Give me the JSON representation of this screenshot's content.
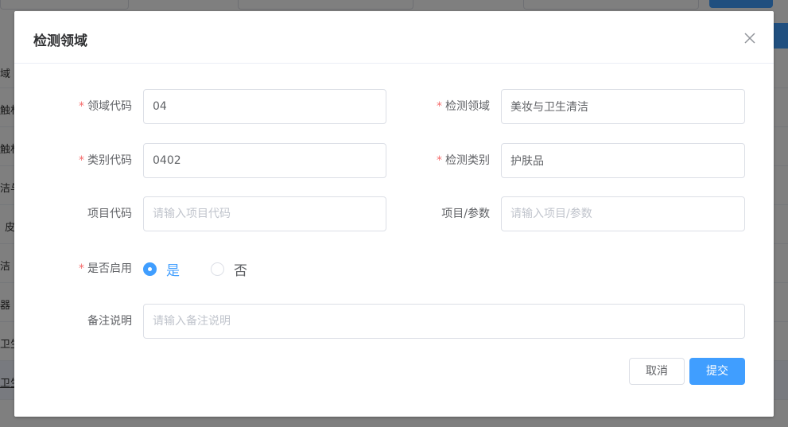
{
  "background": {
    "table_fragments": [
      "域",
      "触材",
      "触材",
      "洁与",
      "皮",
      "洁",
      "器",
      "卫生",
      "卫生"
    ]
  },
  "dialog": {
    "title": "检测领域",
    "fields": {
      "domain_code": {
        "label": "领域代码",
        "required": true,
        "value": "04",
        "placeholder": ""
      },
      "detection_domain": {
        "label": "检测领域",
        "required": true,
        "value": "美妆与卫生清洁",
        "placeholder": ""
      },
      "category_code": {
        "label": "类别代码",
        "required": true,
        "value": "0402",
        "placeholder": ""
      },
      "detection_category": {
        "label": "检测类别",
        "required": true,
        "value": "护肤品",
        "placeholder": ""
      },
      "item_code": {
        "label": "项目代码",
        "required": false,
        "value": "",
        "placeholder": "请输入项目代码"
      },
      "item_param": {
        "label": "项目/参数",
        "required": false,
        "value": "",
        "placeholder": "请输入项目/参数"
      },
      "enabled": {
        "label": "是否启用",
        "required": true,
        "options": [
          "是",
          "否"
        ],
        "selected": "是"
      },
      "remarks": {
        "label": "备注说明",
        "required": false,
        "value": "",
        "placeholder": "请输入备注说明"
      }
    },
    "buttons": {
      "cancel": "取消",
      "submit": "提交"
    }
  },
  "colors": {
    "primary": "#409eff",
    "required": "#f56c6c",
    "overlay": "rgba(0,0,0,0.5)"
  }
}
